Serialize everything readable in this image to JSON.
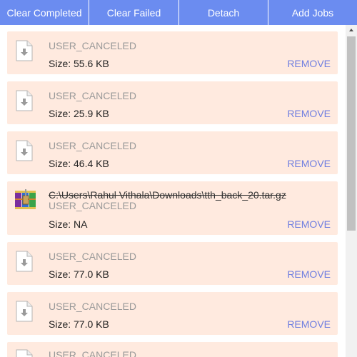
{
  "toolbar": {
    "clear_completed": "Clear Completed",
    "clear_failed": "Clear Failed",
    "detach": "Detach",
    "add_jobs": "Add Jobs",
    "background_color": "#6b8cf0"
  },
  "downloads": [
    {
      "icon": "file-download-icon",
      "title": "",
      "status": "USER_CANCELED",
      "size": "Size: 55.6 KB",
      "action": "REMOVE"
    },
    {
      "icon": "file-download-icon",
      "title": "",
      "status": "USER_CANCELED",
      "size": "Size: 25.9 KB",
      "action": "REMOVE"
    },
    {
      "icon": "file-download-icon",
      "title": "",
      "status": "USER_CANCELED",
      "size": "Size: 46.4 KB",
      "action": "REMOVE"
    },
    {
      "icon": "winrar-archive-icon",
      "title": "C:\\Users\\Rahul Vithala\\Downloads\\tth_back_20.tar.gz",
      "status": "USER_CANCELED",
      "size": "Size: NA",
      "action": "REMOVE"
    },
    {
      "icon": "file-download-icon",
      "title": "",
      "status": "USER_CANCELED",
      "size": "Size: 77.0 KB",
      "action": "REMOVE"
    },
    {
      "icon": "file-download-icon",
      "title": "",
      "status": "USER_CANCELED",
      "size": "Size: 77.0 KB",
      "action": "REMOVE"
    },
    {
      "icon": "file-download-icon",
      "title": "",
      "status": "USER_CANCELED",
      "size": "",
      "action": ""
    }
  ],
  "colors": {
    "item_background": "#ffeadf",
    "status_text": "#999999",
    "remove_link": "#6f7ee0"
  }
}
